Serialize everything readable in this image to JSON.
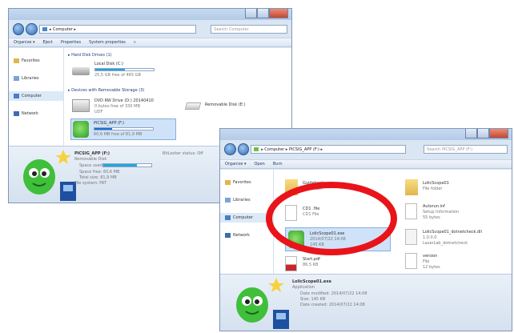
{
  "window1": {
    "address": "▸ Computer ▸",
    "search_placeholder": "Search Computer",
    "toolbar": [
      "Organize ▾",
      "Eject",
      "Properties",
      "System properties",
      "»"
    ],
    "nav": [
      "Favorites",
      "Libraries",
      "Computer",
      "Network"
    ],
    "sections": {
      "hard_disks": "▸ Hard Disk Drives (1)",
      "removable": "▸ Devices with Removable Storage (3)"
    },
    "drives": [
      {
        "name": "Local Disk (C:)",
        "free": "25,5 GB free of 465 GB",
        "usage": 0.5
      },
      {
        "name": "DVD RW Drive (D:) 20140410",
        "free": "0 bytes free of 330 MB",
        "fs": "UDF"
      },
      {
        "name": "Removable Disk (E:)"
      },
      {
        "name": "PICSIG_APP (F:)",
        "free": "60,6 MB free of 81,9 MB",
        "usage": 0.3
      }
    ],
    "details": {
      "title": "PICSIG_APP (F:)",
      "type": "Removable Disk",
      "bitlocker": "BitLocker status: Off",
      "space_used_label": "Space used:",
      "space_free": "Space free: 60,6 MB",
      "total_size": "Total size: 81,9 MB",
      "file_system": "File system: FAT",
      "usage": 0.7
    }
  },
  "window2": {
    "address": "▸ Computer ▸ PICSIG_APP (F:) ▸",
    "search_placeholder": "Search PICSIG_APP (F:)",
    "toolbar": [
      "Organize ▾",
      "Open",
      "Burn"
    ],
    "nav": [
      "Favorites",
      "Libraries",
      "Computer",
      "Network"
    ],
    "files": [
      {
        "name": "Guidebook",
        "type": "File folder"
      },
      {
        "name": "LolicScope01",
        "type": "File folder"
      },
      {
        "name": "CD1 .file",
        "type": "CD1 File"
      },
      {
        "name": "Autorun.inf",
        "type": "Setup Information",
        "size": "55 bytes"
      },
      {
        "name": "LolicScope01.exe",
        "type": "2014/07/22 14:08",
        "size": "145 KB"
      },
      {
        "name": "LolicScope01_dotnetcheck.dll",
        "type": "1.0.0.0",
        "size": "LaserLab_dotnetcheck"
      },
      {
        "name": "Start.pdf",
        "type": "PDF File",
        "size": "86,5 KB"
      },
      {
        "name": "version",
        "type": "File",
        "size": "12 bytes"
      }
    ],
    "details": {
      "title": "LolicScope01.exe",
      "type": "Application",
      "modified": "Date modified: 2014/07/22 14:08",
      "size": "Size: 145 KB",
      "created": "Date created: 2014/07/22 14:08"
    }
  },
  "colors": {
    "accent": "#27a3d8",
    "highlight_ring": "#e8141a",
    "window_bg": "#dbe6f3"
  }
}
